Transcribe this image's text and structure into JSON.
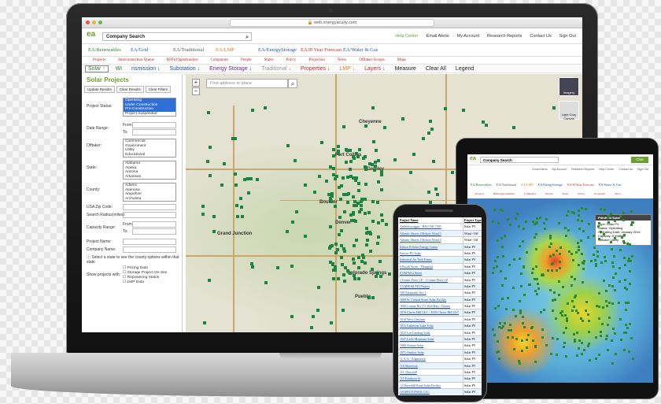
{
  "laptop": {
    "url": "web.energyacuity.com",
    "logo": "ea",
    "logo_sub": "energyacuity",
    "company_search": "Company Search",
    "top_links": [
      "Help Center",
      "Email Alerts",
      "My Account",
      "Research Reports",
      "Contact Us",
      "Sign Out"
    ],
    "products": [
      {
        "label": "EA/Renewables",
        "color": "#2e7d2e"
      },
      {
        "label": "EA/Grid",
        "color": "#2456b5"
      },
      {
        "label": "EA/Traditional",
        "color": "#555555"
      },
      {
        "label": "EA/LMP",
        "color": "#e07b16"
      },
      {
        "label": "EA/EnergyStorage",
        "color": "#2456b5"
      },
      {
        "label": "EA30 Year Forecast",
        "color": "#c62828"
      },
      {
        "label": "EA/Water & Gas",
        "color": "#2456b5"
      }
    ],
    "menu": [
      "Projects",
      "Interconnection Queue",
      "RFPs/Opportunities",
      "Companies",
      "People",
      "States",
      "Policy",
      "Projection",
      "News",
      "Offtaker Scoops",
      "Maps"
    ],
    "filters": [
      {
        "label": "Solar ↑",
        "color": "#2e7d2e",
        "active": true
      },
      {
        "label": "Wi",
        "color": "#2e7d2e"
      },
      {
        "label": "nsmission ↓",
        "color": "#2456b5"
      },
      {
        "label": "Substation ↓",
        "color": "#2456b5"
      },
      {
        "label": "Energy Storage ↓",
        "color": "#6a2aa8"
      },
      {
        "label": "Traditional ↓",
        "color": "#999999"
      },
      {
        "label": "Properties ↓",
        "color": "#c62828"
      },
      {
        "label": "LMP ↓",
        "color": "#e07b16"
      },
      {
        "label": "Layers ↓",
        "color": "#c62828"
      },
      {
        "label": "Measure",
        "color": "#222222"
      },
      {
        "label": "Clear All",
        "color": "#222222"
      },
      {
        "label": "Legend",
        "color": "#222222"
      }
    ],
    "panel": {
      "title": "Solar Projects",
      "buttons": [
        "Update Results",
        "Clear Results",
        "Clear Filters"
      ],
      "project_status_label": "Project Status:",
      "project_status_options": [
        "Operating",
        "Under Construction",
        "Pre-Construction",
        "Project Suspended"
      ],
      "date_range_label": "Date Range:",
      "from_label": "From:",
      "to_label": "To:",
      "offtaker_label": "Offtaker:",
      "offtaker_options": [
        "Commercial",
        "Government",
        "Utility",
        "Educational"
      ],
      "state_label": "State:",
      "state_options": [
        "Alabama",
        "Alaska",
        "Arizona",
        "Arkansas"
      ],
      "county_label": "County:",
      "county_options": [
        "Adams",
        "Alamosa",
        "Arapahoe",
        "Archuleta"
      ],
      "zip_label": "USA Zip Code:",
      "radius_label": "Search Radius(miles):",
      "capacity_label": "Capacity Range:",
      "project_name_label": "Project Name:",
      "company_name_label": "Company Name:",
      "county_hint": "Select a state to see the county options within that state",
      "show_with_label": "Show projects with:",
      "show_with_options": [
        "Pricing Data",
        "Storage Project On-Site",
        "Repowering Status",
        "LMP Data"
      ]
    },
    "map": {
      "search_placeholder": "Find address or place",
      "zoom_in": "+",
      "zoom_out": "−",
      "imagery_label": "Imagery",
      "canvas_label": "Light Gray Canvas",
      "cities": [
        "Cheyenne",
        "Denver",
        "Colorado Springs",
        "Pueblo",
        "Boulder",
        "Grand Junction",
        "Fort Collins",
        "Greeley"
      ]
    }
  },
  "tablet": {
    "company_search": "Company Search",
    "menu_button": "Chat",
    "links": [
      "Email Alerts",
      "My Account",
      "Research Reports",
      "Help Center",
      "Contact Us",
      "Sign Out"
    ],
    "products": [
      "EA/Renewables",
      "EA/Traditional",
      "EA/LMP",
      "EA/EnergyStorage",
      "EA30 Year Forecast",
      "EA/Water & Gas"
    ],
    "menu": [
      "Projects",
      "RFPs/Opportunities",
      "Companies",
      "People",
      "States",
      "Policy",
      "Projection",
      "News"
    ],
    "info": {
      "title": "Pittsfield Solar",
      "type": "Type: Solar PV",
      "status": "Status: Operating",
      "date": "Operating Date: January 2016",
      "capacity": "Capacity: 5.998MW",
      "offtaker": "Offtaker: Utility"
    }
  },
  "phone": {
    "header_name": "Project Name",
    "header_type": "Project Type",
    "rows": [
      {
        "name": "Andrewscoggin - HSO-NE-7585",
        "type": "Solar PV"
      },
      {
        "name": "Atlantic Shores Offshore Wind 3",
        "type": "Wind - Off"
      },
      {
        "name": "Atlantic Shores Offshore Wind 4",
        "type": "Wind - Off"
      },
      {
        "name": "Edison B Solar Energy Center",
        "type": "Solar PV"
      },
      {
        "name": "Furrow B3 Solar",
        "type": "Solar PV"
      },
      {
        "name": "Industrial Air Park Farms",
        "type": "Solar PV"
      },
      {
        "name": "0 Brook Street - Plympton",
        "type": "Solar PV"
      },
      {
        "name": "0 Old West Street",
        "type": "Solar PV"
      },
      {
        "name": "1 Center Place LP - 1 Center Place LP",
        "type": "Solar PV"
      },
      {
        "name": "1.5 MW KI FIT Project",
        "type": "Solar PV"
      },
      {
        "name": "100 Alexander Ave 1",
        "type": "Solar PV"
      },
      {
        "name": "1000 W. Central Street Solar Facility",
        "type": "Solar PV"
      },
      {
        "name": "1000 County Rd 171 Wal-Mart - Duarte",
        "type": "Solar PV"
      },
      {
        "name": "1010 Cherry Hill LLC - 1010 Cherry Hill LLC",
        "type": "Solar PV"
      },
      {
        "name": "1010 West Chestnut",
        "type": "Solar PV"
      },
      {
        "name": "1011 Catherine Lake Solar",
        "type": "Solar PV"
      },
      {
        "name": "1025 Lee Landing Solar",
        "type": "Solar PV"
      },
      {
        "name": "1047 Little Mountain Solar",
        "type": "Solar PV"
      },
      {
        "name": "1066 Avenue Solar",
        "type": "Solar PV"
      },
      {
        "name": "1071 Onslow Solar",
        "type": "Solar PV"
      },
      {
        "name": "11 A.St - Edgartown",
        "type": "Solar PV"
      },
      {
        "name": "110 Shoreway",
        "type": "Solar PV"
      },
      {
        "name": "111 Churchill",
        "type": "Solar PV"
      },
      {
        "name": "115 Pantheon St",
        "type": "Solar PV"
      },
      {
        "name": "12 Haverhill Road Solar Facility",
        "type": "Solar PV"
      },
      {
        "name": "123 PELTONSOL LLC",
        "type": "Solar PV"
      }
    ]
  }
}
